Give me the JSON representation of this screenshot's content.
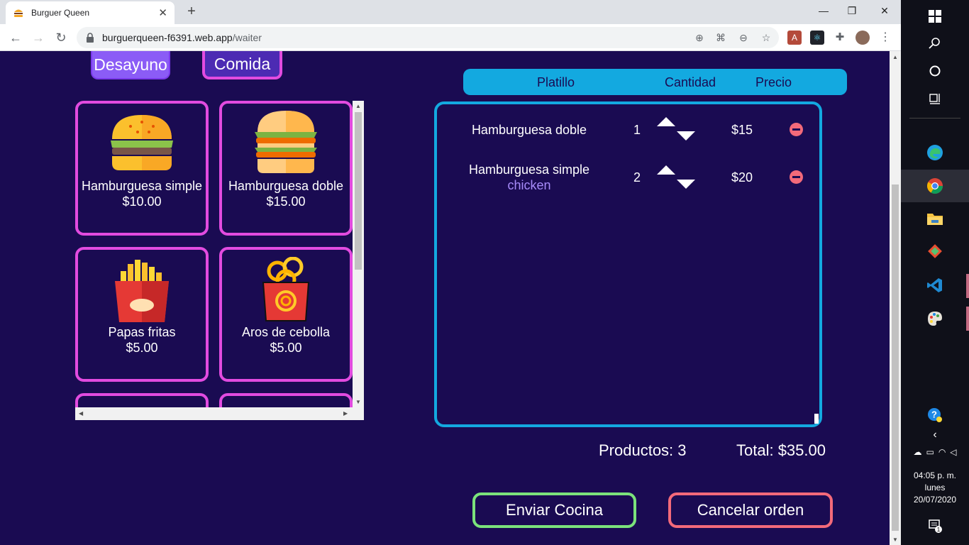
{
  "browser": {
    "tab_title": "Burguer Queen",
    "url_host": "burguerqueen-f6391.web.app",
    "url_path": "/waiter"
  },
  "categories": {
    "desayuno": "Desayuno",
    "comida": "Comida"
  },
  "menu": [
    {
      "name": "Hamburguesa simple",
      "price": "$10.00",
      "icon": "burger-icon"
    },
    {
      "name": "Hamburguesa doble",
      "price": "$15.00",
      "icon": "double-burger-icon"
    },
    {
      "name": "Papas fritas",
      "price": "$5.00",
      "icon": "fries-icon"
    },
    {
      "name": "Aros de cebolla",
      "price": "$5.00",
      "icon": "onion-rings-icon"
    }
  ],
  "order_header": {
    "dish": "Platillo",
    "quantity": "Cantidad",
    "price": "Precio"
  },
  "order_items": [
    {
      "name": "Hamburguesa doble",
      "note": "",
      "qty": "1",
      "price": "$15"
    },
    {
      "name": "Hamburguesa simple",
      "note": "chicken",
      "qty": "2",
      "price": "$20"
    }
  ],
  "summary": {
    "products": "Productos: 3",
    "total": "Total: $35.00"
  },
  "actions": {
    "send": "Enviar Cocina",
    "cancel": "Cancelar orden"
  },
  "taskbar": {
    "time": "04:05 p. m.",
    "day": "lunes",
    "date": "20/07/2020",
    "notifications": "1"
  },
  "colors": {
    "background": "#1a0b52",
    "card_border": "#e24be0",
    "accent_blue": "#13a9e0",
    "send_border": "#7be37b",
    "cancel_border": "#f36a7a"
  }
}
